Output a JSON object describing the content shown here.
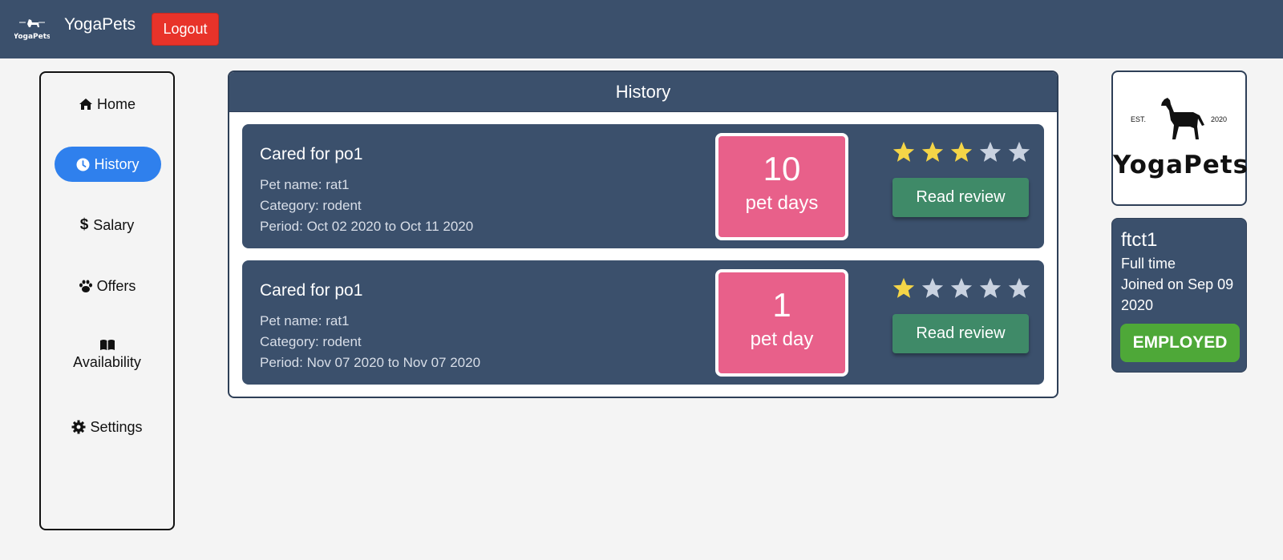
{
  "app": {
    "brand": "YogaPets",
    "logout_label": "Logout",
    "nav_logo_text": "YogaPets"
  },
  "sidebar": {
    "items": [
      {
        "label": "Home",
        "icon": "home-icon",
        "active": false
      },
      {
        "label": "History",
        "icon": "clock-icon",
        "active": true
      },
      {
        "label": "Salary",
        "icon": "dollar-icon",
        "active": false
      },
      {
        "label": "Offers",
        "icon": "paw-icon",
        "active": false
      },
      {
        "label": "Availability",
        "icon": "book-icon",
        "active": false
      },
      {
        "label": "Settings",
        "icon": "gear-icon",
        "active": false
      }
    ]
  },
  "history": {
    "title": "History",
    "records": [
      {
        "title": "Cared for po1",
        "pet_name": "Pet name: rat1",
        "category": "Category: rodent",
        "period": "Period: Oct 02 2020 to Oct 11 2020",
        "days": "10",
        "days_label": "pet days",
        "rating": 3,
        "rating_max": 5,
        "review_label": "Read review"
      },
      {
        "title": "Cared for po1",
        "pet_name": "Pet name: rat1",
        "category": "Category: rodent",
        "period": "Period: Nov 07 2020 to Nov 07 2020",
        "days": "1",
        "days_label": "pet day",
        "rating": 1,
        "rating_max": 5,
        "review_label": "Read review"
      }
    ]
  },
  "logo_card": {
    "est": "EST.",
    "year": "2020",
    "word": "YogaPets"
  },
  "profile": {
    "username": "ftct1",
    "employment_type": "Full time",
    "joined_line1": "Joined on Sep 09",
    "joined_line2": "2020",
    "status": "EMPLOYED"
  },
  "colors": {
    "navbar": "#3b506c",
    "logout": "#e8332a",
    "active_nav": "#2f80ed",
    "days_box": "#e8608a",
    "review_button": "#3f8a68",
    "employed_badge": "#4ea838",
    "star_on": "#f5d547",
    "star_off": "#c9d2e0"
  }
}
